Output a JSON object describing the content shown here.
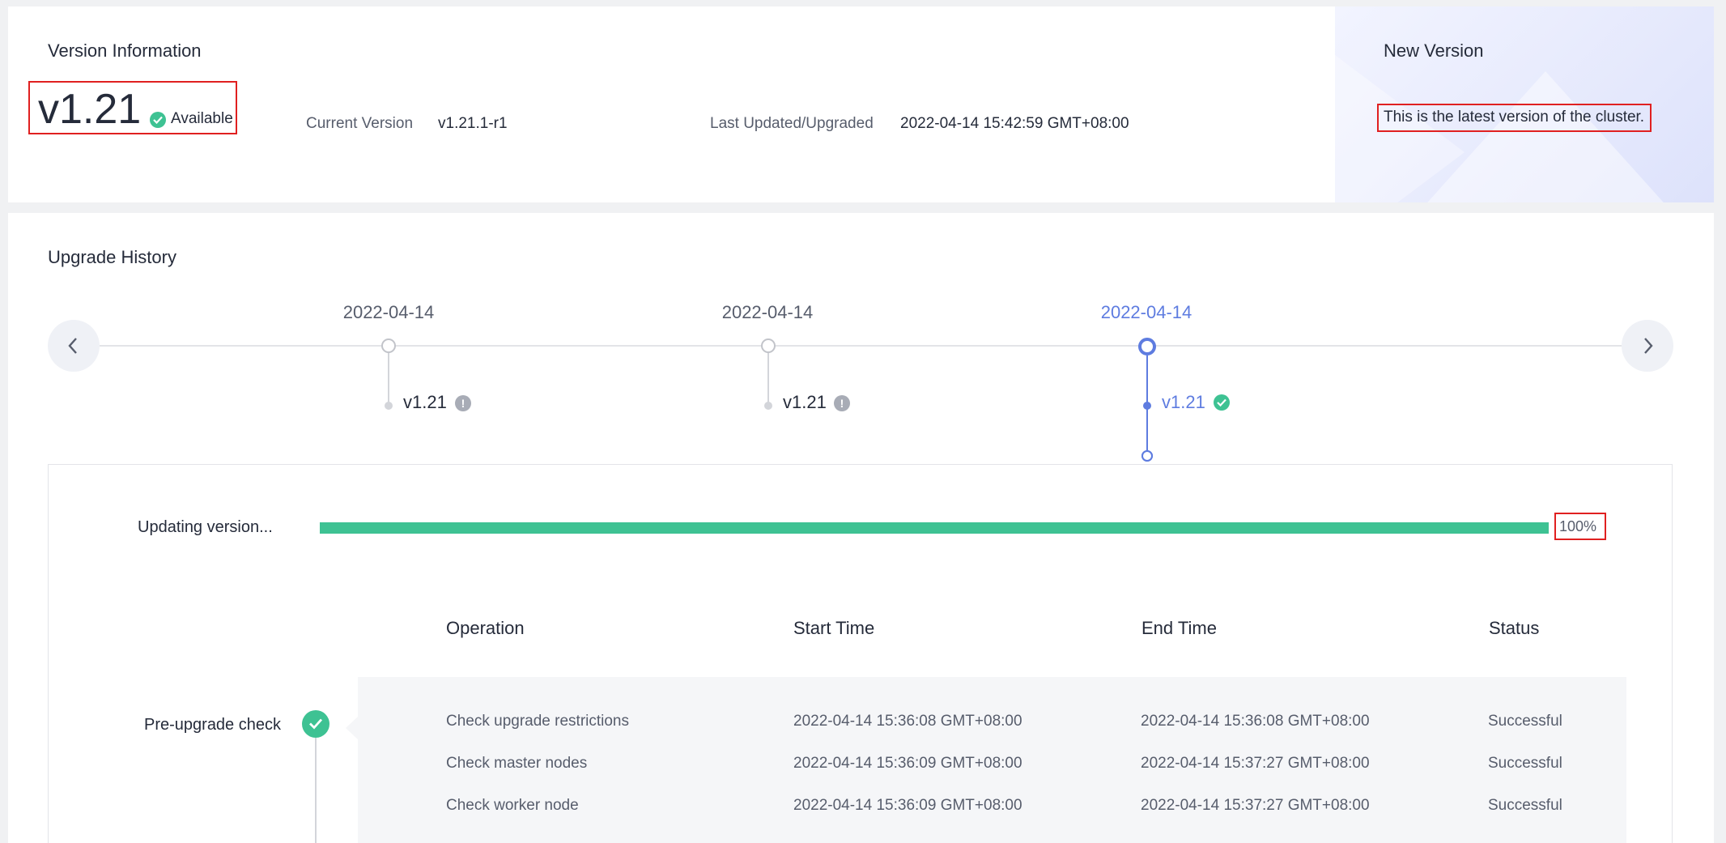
{
  "version_info": {
    "title": "Version Information",
    "major_version": "v1.21",
    "status": "Available",
    "current_version_label": "Current Version",
    "current_version_value": "v1.21.1-r1",
    "last_updated_label": "Last Updated/Upgraded",
    "last_updated_value": "2022-04-14 15:42:59 GMT+08:00"
  },
  "new_version": {
    "title": "New Version",
    "message": "This is the latest version of the cluster."
  },
  "upgrade_history": {
    "title": "Upgrade History",
    "timeline": [
      {
        "date": "2022-04-14",
        "version": "v1.21",
        "status_icon": "exclamation-icon",
        "active": false
      },
      {
        "date": "2022-04-14",
        "version": "v1.21",
        "status_icon": "exclamation-icon",
        "active": false
      },
      {
        "date": "2022-04-14",
        "version": "v1.21",
        "status_icon": "check-icon",
        "active": true
      }
    ],
    "progress": {
      "label": "Updating version...",
      "percent": 100,
      "percent_text": "100%"
    },
    "table": {
      "headers": [
        "Operation",
        "Start Time",
        "End Time",
        "Status"
      ],
      "phase": "Pre-upgrade check",
      "rows": [
        [
          "Check upgrade restrictions",
          "2022-04-14 15:36:08 GMT+08:00",
          "2022-04-14 15:36:08 GMT+08:00",
          "Successful"
        ],
        [
          "Check master nodes",
          "2022-04-14 15:36:09 GMT+08:00",
          "2022-04-14 15:37:27 GMT+08:00",
          "Successful"
        ],
        [
          "Check worker node",
          "2022-04-14 15:36:09 GMT+08:00",
          "2022-04-14 15:37:27 GMT+08:00",
          "Successful"
        ]
      ]
    }
  },
  "colors": {
    "accent": "#5e7ce0",
    "success": "#3ec293",
    "highlight_border": "#e02020"
  }
}
